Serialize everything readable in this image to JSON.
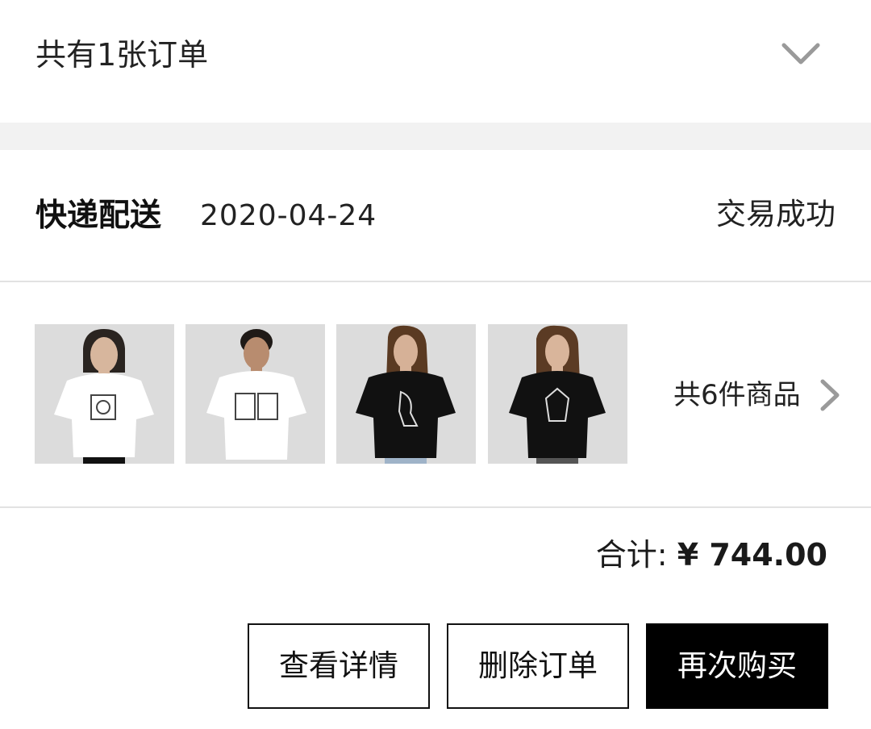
{
  "summary": {
    "title": "共有1张订单",
    "toggle_icon": "chevron-down-icon"
  },
  "order": {
    "delivery_type": "快递配送",
    "date": "2020-04-24",
    "status": "交易成功"
  },
  "products": {
    "thumbnails": [
      {
        "name": "product-thumbnail-1",
        "shirt_color": "#ffffff"
      },
      {
        "name": "product-thumbnail-2",
        "shirt_color": "#ffffff"
      },
      {
        "name": "product-thumbnail-3",
        "shirt_color": "#111111"
      },
      {
        "name": "product-thumbnail-4",
        "shirt_color": "#111111"
      }
    ],
    "count_label": "共6件商品",
    "more_icon": "chevron-right-icon"
  },
  "total": {
    "label": "合计: ",
    "amount": "¥ 744.00"
  },
  "actions": {
    "details_label": "查看详情",
    "delete_label": "删除订单",
    "rebuy_label": "再次购买"
  },
  "colors": {
    "band": "#f2f2f2",
    "divider": "#e2e2e2",
    "primary": "#000000"
  }
}
